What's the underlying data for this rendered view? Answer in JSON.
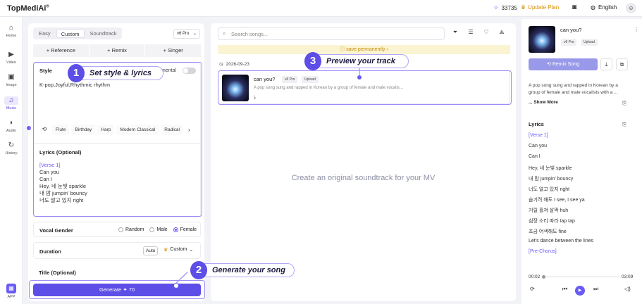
{
  "header": {
    "logo": "TopMediAi",
    "logo_mark": "®",
    "credits": "33735",
    "update_plan": "Update Plan",
    "language": "English"
  },
  "sidebar": {
    "items": [
      {
        "label": "Home",
        "icon": "home-icon"
      },
      {
        "label": "Video",
        "icon": "video-icon"
      },
      {
        "label": "Image",
        "icon": "image-icon"
      },
      {
        "label": "Music",
        "icon": "music-icon"
      },
      {
        "label": "Audio",
        "icon": "audio-icon"
      },
      {
        "label": "History",
        "icon": "history-icon"
      }
    ],
    "app_label": "APP"
  },
  "left": {
    "modes": [
      "Easy",
      "Custom",
      "Soundtrack"
    ],
    "active_mode": "Custom",
    "version": "v6 Pro",
    "actions": [
      "Reference",
      "Remix",
      "Singer"
    ],
    "style_label": "Style",
    "instrumental_label": "mental",
    "style_text": "K-pop,Joyful,Rhythmic rhythm",
    "chips": [
      "Flute",
      "Birthday",
      "Harp",
      "Modern Classical",
      "Radical"
    ],
    "lyrics_label": "Lyrics (Optional)",
    "lyrics": [
      "[Verse 1]",
      "Can you",
      "Can I",
      "Hey, 네 눈빛 sparkle",
      "내 맘 jumpin' bouncy",
      "너도 알고 있지 right"
    ],
    "vocal_label": "Vocal Gender",
    "vocal_options": [
      "Random",
      "Male",
      "Female"
    ],
    "duration_label": "Duration",
    "duration_auto": "Auto",
    "duration_custom": "Custom",
    "title_label": "Title (Optional)",
    "generate_label": "Generate",
    "generate_cost": "70"
  },
  "middle": {
    "search_placeholder": "Search songs...",
    "save_text": "save permanently ›",
    "date": "2026-09-23",
    "track": {
      "title": "can you?",
      "badge_version": "v6 Pro",
      "badge_upload": "Upload",
      "desc": "A pop song sung and rapped in Korean by a group of female and male vocalis..."
    },
    "empty_msg": "Create an original soundtrack for your MV"
  },
  "right": {
    "title": "can you?",
    "badge_version": "v6 Pro",
    "badge_upload": "Upload",
    "remix_label": "Remix Song",
    "desc": "A pop song sung and rapped in Korean by a group of female and male vocalists with a ...",
    "show_more": "... Show More",
    "lyrics_label": "Lyrics",
    "lyrics": [
      "[Verse 1]",
      "Can you",
      "Can I",
      "Hey, 네 눈빛 sparkle",
      "내 맘 jumpin' bouncy",
      "너도 알고 있지 right",
      "숨기려 해도 I see, I see ya",
      "거릴 흘쳐 살짝 huh",
      "심장 소리 따라 tap tap",
      "조금 어색해도 fine",
      "Let's dance between the lines",
      "[Pre-Chorus]"
    ],
    "time_current": "00:02",
    "time_total": "03:09"
  },
  "tutorial": {
    "step1_num": "1",
    "step1_text": "Set style & lyrics",
    "step2_num": "2",
    "step2_text": "Generate your song",
    "step3_num": "3",
    "step3_text": "Preview your track"
  },
  "colors": {
    "accent": "#5c4ee6",
    "highlight": "#9d8cf7",
    "warning": "#d78f08"
  }
}
